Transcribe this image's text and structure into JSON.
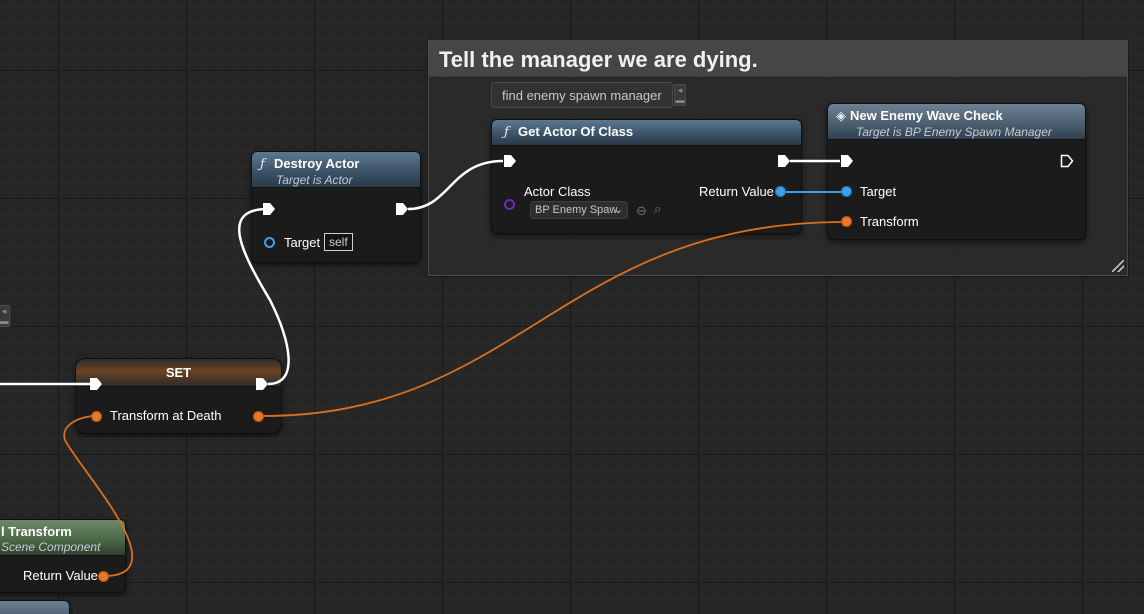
{
  "comment": {
    "title": "Tell the manager we are dying."
  },
  "bubble": {
    "text": "find enemy spawn manager"
  },
  "destroy_actor": {
    "title": "Destroy Actor",
    "subtitle": "Target is Actor",
    "target_label": "Target",
    "target_default": "self",
    "icon": "function-icon"
  },
  "get_actor_of_class": {
    "title": "Get Actor Of Class",
    "actor_class_label": "Actor Class",
    "actor_class_value": "BP Enemy Spaw",
    "return_label": "Return Value",
    "icon": "function-icon"
  },
  "wave_check": {
    "title": "New Enemy Wave Check",
    "subtitle": "Target is BP Enemy Spawn Manager",
    "target_label": "Target",
    "transform_label": "Transform",
    "icon": "event-icon"
  },
  "set_node": {
    "title": "SET",
    "var_label": "Transform at Death"
  },
  "get_transform": {
    "title": "l Transform",
    "subtitle": "Scene Component",
    "return_label": "Return Value"
  },
  "colors": {
    "exec": "#ffffff",
    "transform": "#e8782b",
    "object": "#3d9fe8",
    "class": "#6a2bb8"
  }
}
